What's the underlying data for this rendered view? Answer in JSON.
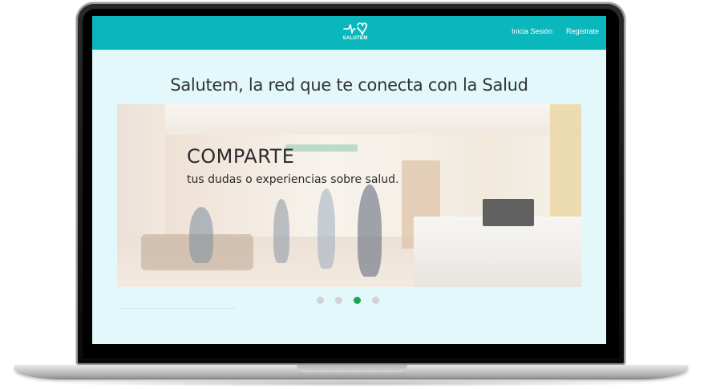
{
  "navbar": {
    "logo_text": "SALUTEM",
    "links": [
      {
        "label": "Inicia Sesión"
      },
      {
        "label": "Registrate"
      }
    ]
  },
  "headline": "Salutem, la red que te conecta con la Salud",
  "carousel": {
    "slide_title": "COMPARTE",
    "slide_text": "tus dudas o experiencias sobre salud.",
    "indicator_count": 4,
    "active_index": 2
  },
  "colors": {
    "navbar_bg": "#0ab7bd",
    "page_bg": "#e3f8fb",
    "active_dot": "#1aa64e",
    "inactive_dot": "#cfd3d4"
  }
}
